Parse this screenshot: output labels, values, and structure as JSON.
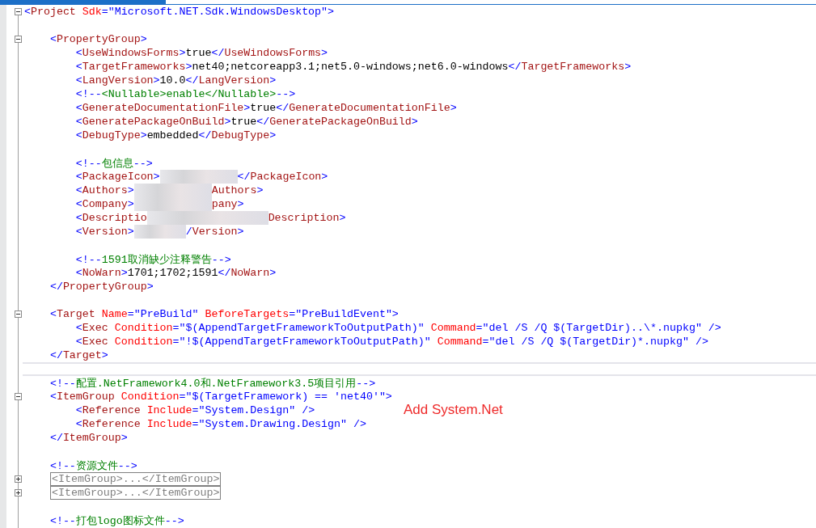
{
  "editor": {
    "annotation": "Add System.Net",
    "lines": [
      {
        "kind": "fold-start",
        "current": false,
        "tokens": [
          {
            "kind": "bracket",
            "text": "<"
          },
          {
            "kind": "tag",
            "text": "Project"
          },
          {
            "kind": "attr",
            "text": " Sdk"
          },
          {
            "kind": "bracket",
            "text": "=\"Microsoft.NET.Sdk.WindowsDesktop\">"
          }
        ]
      },
      {
        "kind": "plain",
        "current": false
      },
      {
        "kind": "fold-start",
        "current": false,
        "tokens": [
          {
            "kind": "bracket",
            "text": "    <"
          },
          {
            "kind": "tag",
            "text": "PropertyGroup"
          },
          {
            "kind": "bracket",
            "text": ">"
          }
        ]
      },
      {
        "kind": "plain",
        "current": false,
        "tokens": [
          {
            "kind": "bracket",
            "text": "        <"
          },
          {
            "kind": "tag",
            "text": "UseWindowsForms"
          },
          {
            "kind": "bracket",
            "text": ">"
          },
          {
            "kind": "text",
            "text": "true"
          },
          {
            "kind": "bracket",
            "text": "</"
          },
          {
            "kind": "tag",
            "text": "UseWindowsForms"
          },
          {
            "kind": "bracket",
            "text": ">"
          }
        ]
      },
      {
        "kind": "plain",
        "current": false,
        "tokens": [
          {
            "kind": "bracket",
            "text": "        <"
          },
          {
            "kind": "tag",
            "text": "TargetFrameworks"
          },
          {
            "kind": "bracket",
            "text": ">"
          },
          {
            "kind": "text",
            "text": "net40;netcoreapp3.1;net5.0-windows;net6.0-windows"
          },
          {
            "kind": "bracket",
            "text": "</"
          },
          {
            "kind": "tag",
            "text": "TargetFrameworks"
          },
          {
            "kind": "bracket",
            "text": ">"
          }
        ]
      },
      {
        "kind": "plain",
        "current": false,
        "tokens": [
          {
            "kind": "bracket",
            "text": "        <"
          },
          {
            "kind": "tag",
            "text": "LangVersion"
          },
          {
            "kind": "bracket",
            "text": ">"
          },
          {
            "kind": "text",
            "text": "10.0"
          },
          {
            "kind": "bracket",
            "text": "</"
          },
          {
            "kind": "tag",
            "text": "LangVersion"
          },
          {
            "kind": "bracket",
            "text": ">"
          }
        ]
      },
      {
        "kind": "plain",
        "current": false,
        "tokens": [
          {
            "kind": "bracket",
            "text": "        <!--"
          },
          {
            "kind": "comment",
            "text": "<Nullable>enable</Nullable>"
          },
          {
            "kind": "bracket",
            "text": "-->"
          }
        ]
      },
      {
        "kind": "plain",
        "current": false,
        "tokens": [
          {
            "kind": "bracket",
            "text": "        <"
          },
          {
            "kind": "tag",
            "text": "GenerateDocumentationFile"
          },
          {
            "kind": "bracket",
            "text": ">"
          },
          {
            "kind": "text",
            "text": "true"
          },
          {
            "kind": "bracket",
            "text": "</"
          },
          {
            "kind": "tag",
            "text": "GenerateDocumentationFile"
          },
          {
            "kind": "bracket",
            "text": ">"
          }
        ]
      },
      {
        "kind": "plain",
        "current": false,
        "tokens": [
          {
            "kind": "bracket",
            "text": "        <"
          },
          {
            "kind": "tag",
            "text": "GeneratePackageOnBuild"
          },
          {
            "kind": "bracket",
            "text": ">"
          },
          {
            "kind": "text",
            "text": "true"
          },
          {
            "kind": "bracket",
            "text": "</"
          },
          {
            "kind": "tag",
            "text": "GeneratePackageOnBuild"
          },
          {
            "kind": "bracket",
            "text": ">"
          }
        ]
      },
      {
        "kind": "plain",
        "current": false,
        "tokens": [
          {
            "kind": "bracket",
            "text": "        <"
          },
          {
            "kind": "tag",
            "text": "DebugType"
          },
          {
            "kind": "bracket",
            "text": ">"
          },
          {
            "kind": "text",
            "text": "embedded"
          },
          {
            "kind": "bracket",
            "text": "</"
          },
          {
            "kind": "tag",
            "text": "DebugType"
          },
          {
            "kind": "bracket",
            "text": ">"
          }
        ]
      },
      {
        "kind": "plain",
        "current": false
      },
      {
        "kind": "plain",
        "current": false,
        "tokens": [
          {
            "kind": "bracket",
            "text": "        <!--"
          },
          {
            "kind": "comment",
            "text": "包信息"
          },
          {
            "kind": "bracket",
            "text": "-->"
          }
        ]
      },
      {
        "kind": "plain",
        "current": false,
        "tokens": [
          {
            "kind": "bracket",
            "text": "        <"
          },
          {
            "kind": "tag",
            "text": "PackageIcon"
          },
          {
            "kind": "bracket",
            "text": ">"
          },
          {
            "kind": "redacted-medium"
          },
          {
            "kind": "bracket",
            "text": "</"
          },
          {
            "kind": "tag",
            "text": "PackageIcon"
          },
          {
            "kind": "bracket",
            "text": ">"
          }
        ]
      },
      {
        "kind": "plain",
        "current": false,
        "tokens": [
          {
            "kind": "bracket",
            "text": "        <"
          },
          {
            "kind": "tag",
            "text": "Authors"
          },
          {
            "kind": "bracket",
            "text": ">"
          },
          {
            "kind": "redacted-medium"
          },
          {
            "kind": "tag",
            "text": "Authors"
          },
          {
            "kind": "bracket",
            "text": ">"
          }
        ]
      },
      {
        "kind": "plain",
        "current": false,
        "tokens": [
          {
            "kind": "bracket",
            "text": "        <"
          },
          {
            "kind": "tag",
            "text": "Company"
          },
          {
            "kind": "bracket",
            "text": ">"
          },
          {
            "kind": "redacted-medium"
          },
          {
            "kind": "tag",
            "text": "pany"
          },
          {
            "kind": "bracket",
            "text": ">"
          }
        ]
      },
      {
        "kind": "plain",
        "current": false,
        "tokens": [
          {
            "kind": "bracket",
            "text": "        <"
          },
          {
            "kind": "tag",
            "text": "Descriptio"
          },
          {
            "kind": "redacted-long"
          },
          {
            "kind": "tag",
            "text": "Description"
          },
          {
            "kind": "bracket",
            "text": ">"
          }
        ]
      },
      {
        "kind": "plain",
        "current": false,
        "tokens": [
          {
            "kind": "bracket",
            "text": "        <"
          },
          {
            "kind": "tag",
            "text": "Version"
          },
          {
            "kind": "bracket",
            "text": ">"
          },
          {
            "kind": "redacted-short"
          },
          {
            "kind": "bracket",
            "text": "/"
          },
          {
            "kind": "tag",
            "text": "Version"
          },
          {
            "kind": "bracket",
            "text": ">"
          }
        ]
      },
      {
        "kind": "plain",
        "current": false
      },
      {
        "kind": "plain",
        "current": false,
        "tokens": [
          {
            "kind": "bracket",
            "text": "        <!--"
          },
          {
            "kind": "comment",
            "text": "1591取消缺少注释警告"
          },
          {
            "kind": "bracket",
            "text": "-->"
          }
        ]
      },
      {
        "kind": "plain",
        "current": false,
        "tokens": [
          {
            "kind": "bracket",
            "text": "        <"
          },
          {
            "kind": "tag",
            "text": "NoWarn"
          },
          {
            "kind": "bracket",
            "text": ">"
          },
          {
            "kind": "text",
            "text": "1701;1702;1591"
          },
          {
            "kind": "bracket",
            "text": "</"
          },
          {
            "kind": "tag",
            "text": "NoWarn"
          },
          {
            "kind": "bracket",
            "text": ">"
          }
        ]
      },
      {
        "kind": "plain",
        "current": false,
        "tokens": [
          {
            "kind": "bracket",
            "text": "    </"
          },
          {
            "kind": "tag",
            "text": "PropertyGroup"
          },
          {
            "kind": "bracket",
            "text": ">"
          }
        ]
      },
      {
        "kind": "plain",
        "current": false
      },
      {
        "kind": "fold-start",
        "current": false,
        "tokens": [
          {
            "kind": "bracket",
            "text": "    <"
          },
          {
            "kind": "tag",
            "text": "Target"
          },
          {
            "kind": "attr",
            "text": " Name"
          },
          {
            "kind": "bracket",
            "text": "=\"PreBuild\""
          },
          {
            "kind": "attr",
            "text": " BeforeTargets"
          },
          {
            "kind": "bracket",
            "text": "=\"PreBuildEvent\">"
          }
        ]
      },
      {
        "kind": "plain",
        "current": false,
        "tokens": [
          {
            "kind": "bracket",
            "text": "        <"
          },
          {
            "kind": "tag",
            "text": "Exec"
          },
          {
            "kind": "attr",
            "text": " Condition"
          },
          {
            "kind": "bracket",
            "text": "=\"$(AppendTargetFrameworkToOutputPath)\""
          },
          {
            "kind": "attr",
            "text": " Command"
          },
          {
            "kind": "bracket",
            "text": "=\"del /S /Q $(TargetDir)..\\*.nupkg\" />"
          }
        ]
      },
      {
        "kind": "plain",
        "current": false,
        "tokens": [
          {
            "kind": "bracket",
            "text": "        <"
          },
          {
            "kind": "tag",
            "text": "Exec"
          },
          {
            "kind": "attr",
            "text": " Condition"
          },
          {
            "kind": "bracket",
            "text": "=\"!$(AppendTargetFrameworkToOutputPath)\""
          },
          {
            "kind": "attr",
            "text": " Command"
          },
          {
            "kind": "bracket",
            "text": "=\"del /S /Q $(TargetDir)*.nupkg\" />"
          }
        ]
      },
      {
        "kind": "plain",
        "current": false,
        "tokens": [
          {
            "kind": "bracket",
            "text": "    </"
          },
          {
            "kind": "tag",
            "text": "Target"
          },
          {
            "kind": "bracket",
            "text": ">"
          }
        ]
      },
      {
        "kind": "plain",
        "current": true
      },
      {
        "kind": "plain",
        "current": false,
        "tokens": [
          {
            "kind": "bracket",
            "text": "    <!--"
          },
          {
            "kind": "comment",
            "text": "配置.NetFramework4.0和.NetFramework3.5项目引用"
          },
          {
            "kind": "bracket",
            "text": "-->"
          }
        ]
      },
      {
        "kind": "fold-start",
        "current": false,
        "tokens": [
          {
            "kind": "bracket",
            "text": "    <"
          },
          {
            "kind": "tag",
            "text": "ItemGroup"
          },
          {
            "kind": "attr",
            "text": " Condition"
          },
          {
            "kind": "bracket",
            "text": "=\"$(TargetFramework) == 'net40'\">"
          }
        ]
      },
      {
        "kind": "plain",
        "current": false,
        "tokens": [
          {
            "kind": "bracket",
            "text": "        <"
          },
          {
            "kind": "tag",
            "text": "Reference"
          },
          {
            "kind": "attr",
            "text": " Include"
          },
          {
            "kind": "bracket",
            "text": "=\"System.Design\" />"
          }
        ]
      },
      {
        "kind": "plain",
        "current": false,
        "tokens": [
          {
            "kind": "bracket",
            "text": "        <"
          },
          {
            "kind": "tag",
            "text": "Reference"
          },
          {
            "kind": "attr",
            "text": " Include"
          },
          {
            "kind": "bracket",
            "text": "=\"System.Drawing.Design\" />"
          }
        ]
      },
      {
        "kind": "plain",
        "current": false,
        "tokens": [
          {
            "kind": "bracket",
            "text": "    </"
          },
          {
            "kind": "tag",
            "text": "ItemGroup"
          },
          {
            "kind": "bracket",
            "text": ">"
          }
        ]
      },
      {
        "kind": "plain",
        "current": false
      },
      {
        "kind": "plain",
        "current": false,
        "tokens": [
          {
            "kind": "bracket",
            "text": "    <!--"
          },
          {
            "kind": "comment",
            "text": "资源文件"
          },
          {
            "kind": "bracket",
            "text": "-->"
          }
        ]
      },
      {
        "kind": "collapsed",
        "current": false,
        "collapsed_text": "<ItemGroup>...</ItemGroup>"
      },
      {
        "kind": "collapsed",
        "current": false,
        "collapsed_text": "<ItemGroup>...</ItemGroup>"
      },
      {
        "kind": "plain",
        "current": false
      },
      {
        "kind": "plain",
        "current": false,
        "tokens": [
          {
            "kind": "bracket",
            "text": "    <!--"
          },
          {
            "kind": "comment",
            "text": "打包logo图标文件"
          },
          {
            "kind": "bracket",
            "text": "-->"
          }
        ]
      }
    ]
  }
}
